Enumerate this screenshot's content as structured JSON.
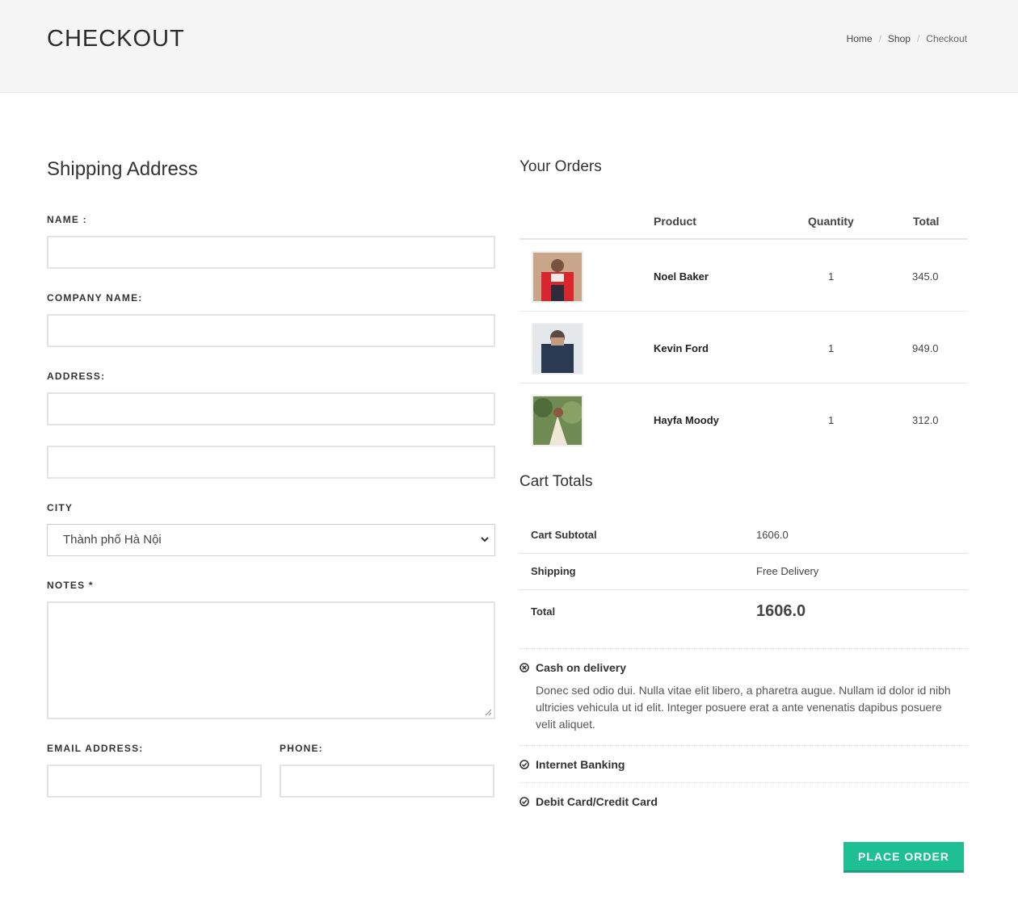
{
  "header": {
    "title": "CHECKOUT",
    "breadcrumb": [
      "Home",
      "Shop",
      "Checkout"
    ],
    "breadcrumb_sep": "/"
  },
  "shipping": {
    "title": "Shipping Address",
    "name_label": "NAME :",
    "company_label": "COMPANY NAME:",
    "address_label": "ADDRESS:",
    "city_label": "CITY",
    "city_value": "Thành phố Hà Nội",
    "notes_label": "NOTES *",
    "email_label": "EMAIL ADDRESS:",
    "phone_label": "PHONE:"
  },
  "orders": {
    "title": "Your Orders",
    "columns": [
      "Product",
      "Quantity",
      "Total"
    ],
    "rows": [
      {
        "product": "Noel Baker",
        "quantity": "1",
        "total": "345.0"
      },
      {
        "product": "Kevin Ford",
        "quantity": "1",
        "total": "949.0"
      },
      {
        "product": "Hayfa Moody",
        "quantity": "1",
        "total": "312.0"
      }
    ]
  },
  "totals": {
    "title": "Cart Totals",
    "subtotal_label": "Cart Subtotal",
    "subtotal_value": "1606.0",
    "shipping_label": "Shipping",
    "shipping_value": "Free Delivery",
    "total_label": "Total",
    "total_value": "1606.0"
  },
  "payments": {
    "cod_label": "Cash on delivery",
    "cod_desc": "Donec sed odio dui. Nulla vitae elit libero, a pharetra augue. Nullam id dolor id nibh ultricies vehicula ut id elit. Integer posuere erat a ante venenatis dapibus posuere velit aliquet.",
    "banking_label": "Internet Banking",
    "card_label": "Debit Card/Credit Card"
  },
  "actions": {
    "place_order": "PLACE ORDER"
  },
  "colors": {
    "accent": "#1fbf94",
    "header_bg": "#f5f5f5"
  }
}
